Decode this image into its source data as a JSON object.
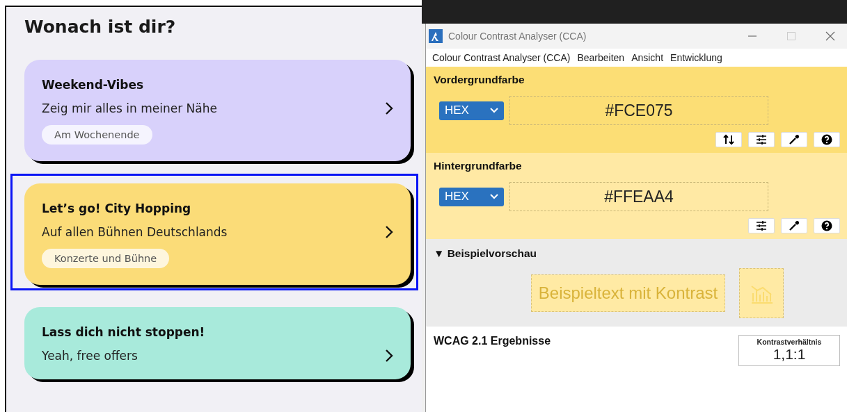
{
  "app": {
    "heading": "Wonach ist dir?",
    "cards": [
      {
        "title": "Weekend-Vibes",
        "subtitle": "Zeig mir alles in meiner Nähe",
        "tag": "Am Wochenende",
        "color": "#d8d1fb",
        "selected": false
      },
      {
        "title": "Let’s go! City Hopping",
        "subtitle": "Auf allen Bühnen Deutschlands",
        "tag": "Konzerte und Bühne",
        "color": "#fbdc78",
        "selected": true
      },
      {
        "title": "Lass dich nicht stoppen!",
        "subtitle": "Yeah, free offers",
        "color": "#a8eadb",
        "selected": false
      }
    ]
  },
  "window": {
    "title": "Colour Contrast Analyser (CCA)",
    "menu": [
      "Colour Contrast Analyser (CCA)",
      "Bearbeiten",
      "Ansicht",
      "Entwicklung"
    ],
    "sections": [
      {
        "kind": "foreground",
        "heading": "Vordergrundfarbe",
        "format": "HEX",
        "value": "#FCE075",
        "tools": [
          {
            "kind": "swap"
          },
          {
            "kind": "sliders"
          },
          {
            "kind": "picker"
          },
          {
            "kind": "help"
          }
        ]
      },
      {
        "kind": "background",
        "heading": "Hintergrundfarbe",
        "format": "HEX",
        "value": "#FFEAA4",
        "tools": [
          {
            "kind": "sliders"
          },
          {
            "kind": "picker"
          },
          {
            "kind": "help"
          }
        ]
      }
    ],
    "preview": {
      "toggle": "▼",
      "heading": "Beispielvorschau",
      "sample": "Beispieltext mit Kontrast"
    },
    "results": {
      "heading": "WCAG 2.1 Ergebnisse",
      "ratio_label": "Kontrastverhältnis",
      "ratio": "1,1:1"
    }
  }
}
